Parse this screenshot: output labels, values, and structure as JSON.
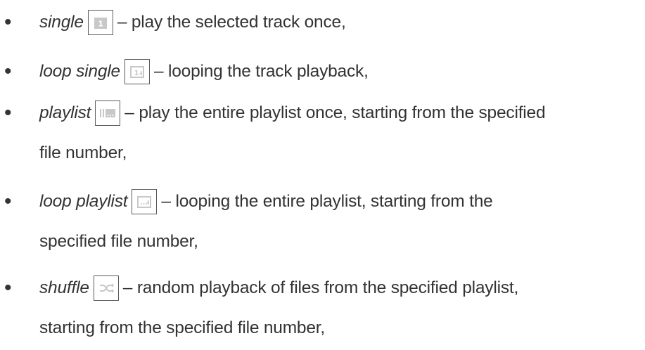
{
  "items": [
    {
      "mode": "single",
      "icon": "single-play-icon",
      "text": "– play the selected track once,",
      "text2": ""
    },
    {
      "mode": "loop single",
      "icon": "loop-single-icon",
      "text": "– looping the track playback,",
      "text2": ""
    },
    {
      "mode": "playlist",
      "icon": "playlist-icon",
      "text": "– play the entire playlist once, starting from the specified",
      "text2": "file number,"
    },
    {
      "mode": "loop playlist",
      "icon": "loop-playlist-icon",
      "text": "– looping the entire playlist, starting from the",
      "text2": "specified file number,"
    },
    {
      "mode": "shuffle",
      "icon": "shuffle-icon",
      "text": "– random playback of files from the specified playlist,",
      "text2": "starting from the specified file number,"
    }
  ],
  "colors": {
    "text": "#333333",
    "icon_border": "#5a5a5a",
    "icon_fill": "#c8c8c8"
  }
}
